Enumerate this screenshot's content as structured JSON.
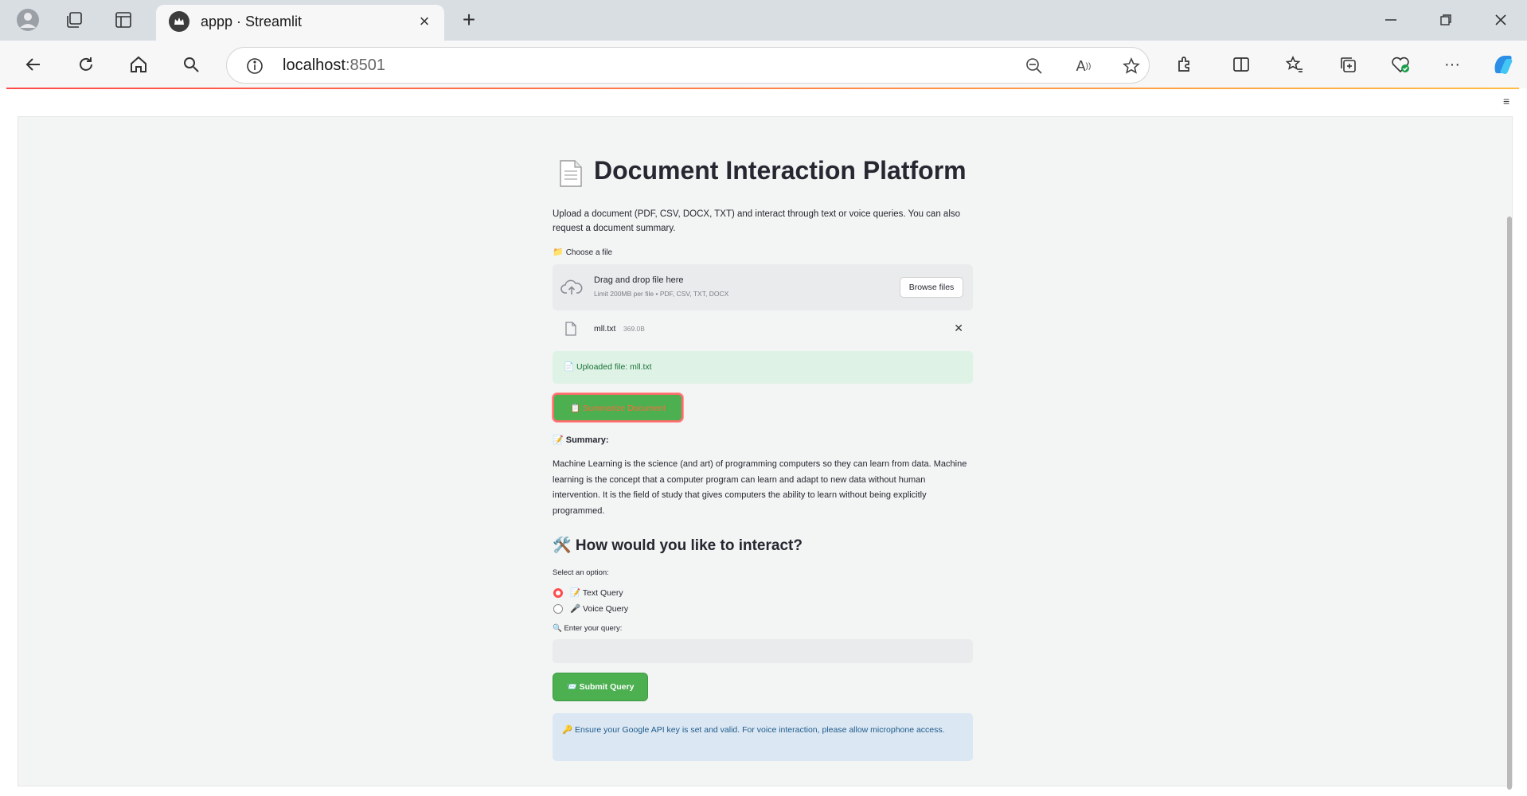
{
  "browser": {
    "tab_title": "appp · Streamlit",
    "url_host": "localhost",
    "url_port": ":8501"
  },
  "app": {
    "title": "Document Interaction Platform",
    "intro": "Upload a document (PDF, CSV, DOCX, TXT) and interact through text or voice queries. You can also request a document summary.",
    "file_label": "Choose a file",
    "file_label_icon": "📁",
    "dropzone_title": "Drag and drop file here",
    "dropzone_limit": "Limit 200MB per file • PDF, CSV, TXT, DOCX",
    "browse_label": "Browse files",
    "uploaded_file_name": "mll.txt",
    "uploaded_file_size": "369.0B",
    "success_message": "📄 Uploaded file: mll.txt",
    "summarize_label": "📋 Summarize Document",
    "summary_label": "📝 Summary:",
    "summary_text": "Machine Learning is the science (and art) of programming computers so they can learn from data. Machine learning is the concept that a computer program can learn and adapt to new data without human intervention. It is the field of study that gives computers the ability to learn without being explicitly programmed.",
    "interact_heading": "🛠️ How would you like to interact?",
    "option_label": "Select an option:",
    "options": [
      {
        "label": "📝 Text Query",
        "selected": true
      },
      {
        "label": "🎤 Voice Query",
        "selected": false
      }
    ],
    "query_label": "🔍 Enter your query:",
    "query_value": "",
    "submit_label": "📨 Submit Query",
    "info_message": "🔑 Ensure your Google API key is set and valid. For voice interaction, please allow microphone access."
  },
  "colors": {
    "accent": "#ff4b4b",
    "button_green": "#4caf50",
    "success_bg": "#dff2e6",
    "info_bg": "#dbe7f2"
  }
}
